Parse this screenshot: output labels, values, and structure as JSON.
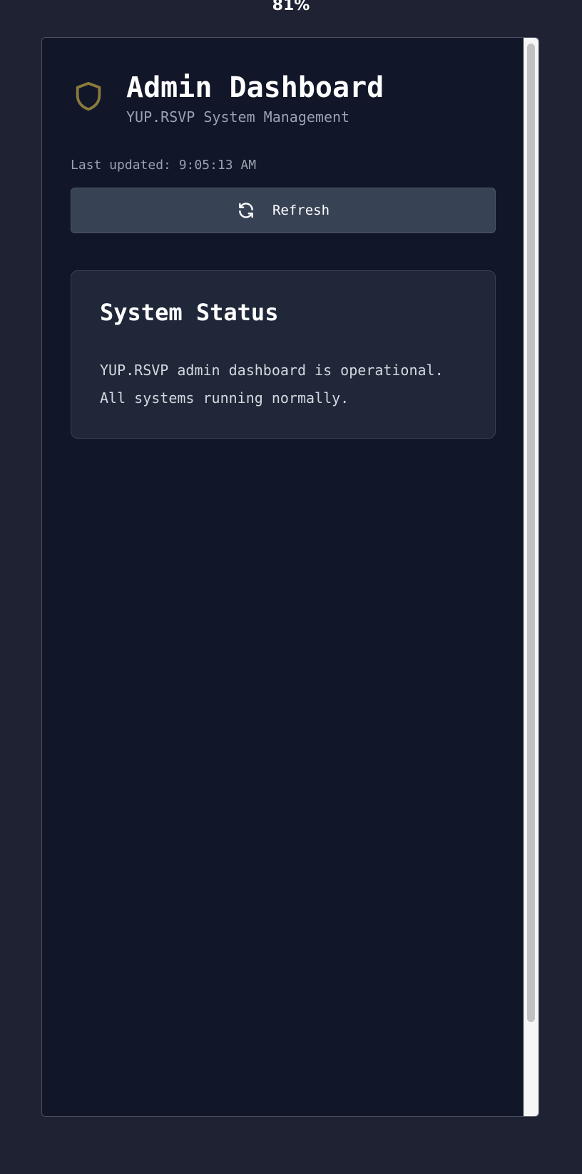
{
  "zoom": "81%",
  "header": {
    "title": "Admin Dashboard",
    "subtitle": "YUP.RSVP System Management",
    "icon": "shield-icon"
  },
  "last_updated": "Last updated: 9:05:13 AM",
  "refresh_button": {
    "label": "Refresh",
    "icon": "refresh-icon"
  },
  "status_card": {
    "title": "System Status",
    "text": "YUP.RSVP admin dashboard is operational. All systems running normally."
  },
  "colors": {
    "page_background": "#1f2232",
    "panel_background": "#111628",
    "card_background": "#1f2738",
    "button_background": "#374254",
    "accent_shield": "#8a7b3c",
    "text_primary": "#ffffff",
    "text_muted": "#9aa1b0"
  }
}
